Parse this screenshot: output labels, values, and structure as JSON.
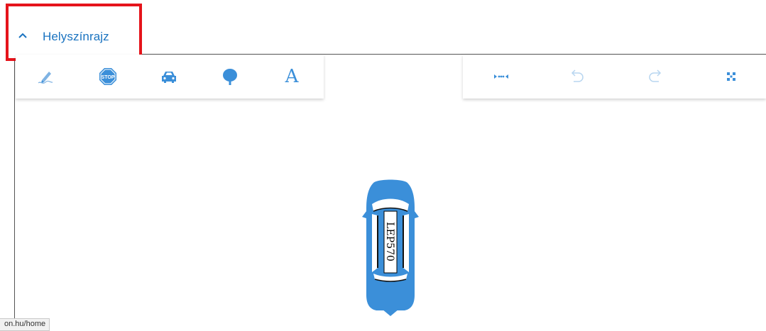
{
  "section": {
    "title": "Helyszínrajz",
    "expanded": true,
    "highlight_color": "#e5141b"
  },
  "toolbar_left": {
    "tools": [
      {
        "name": "draw-tool",
        "icon": "pen-icon"
      },
      {
        "name": "sign-tool",
        "icon": "stop-sign-icon",
        "icon_text": "STOP"
      },
      {
        "name": "vehicle-tool",
        "icon": "car-icon"
      },
      {
        "name": "tree-tool",
        "icon": "tree-icon"
      },
      {
        "name": "text-tool",
        "icon": "text-icon",
        "glyph": "A"
      }
    ]
  },
  "toolbar_right": {
    "tools": [
      {
        "name": "collapse-tool",
        "icon": "arrows-inward-icon"
      },
      {
        "name": "undo-tool",
        "icon": "undo-icon",
        "enabled": false
      },
      {
        "name": "redo-tool",
        "icon": "redo-icon",
        "enabled": false
      },
      {
        "name": "fullscreen-tool",
        "icon": "expand-icon"
      }
    ]
  },
  "canvas": {
    "vehicle": {
      "plate": "LEP570",
      "color": "#3b8fd9"
    }
  },
  "status_bar": {
    "url_text": "on.hu/home"
  },
  "colors": {
    "accent": "#3b8fd9",
    "title_text": "#1a73c0",
    "disabled_icon": "#b8d6f0"
  }
}
